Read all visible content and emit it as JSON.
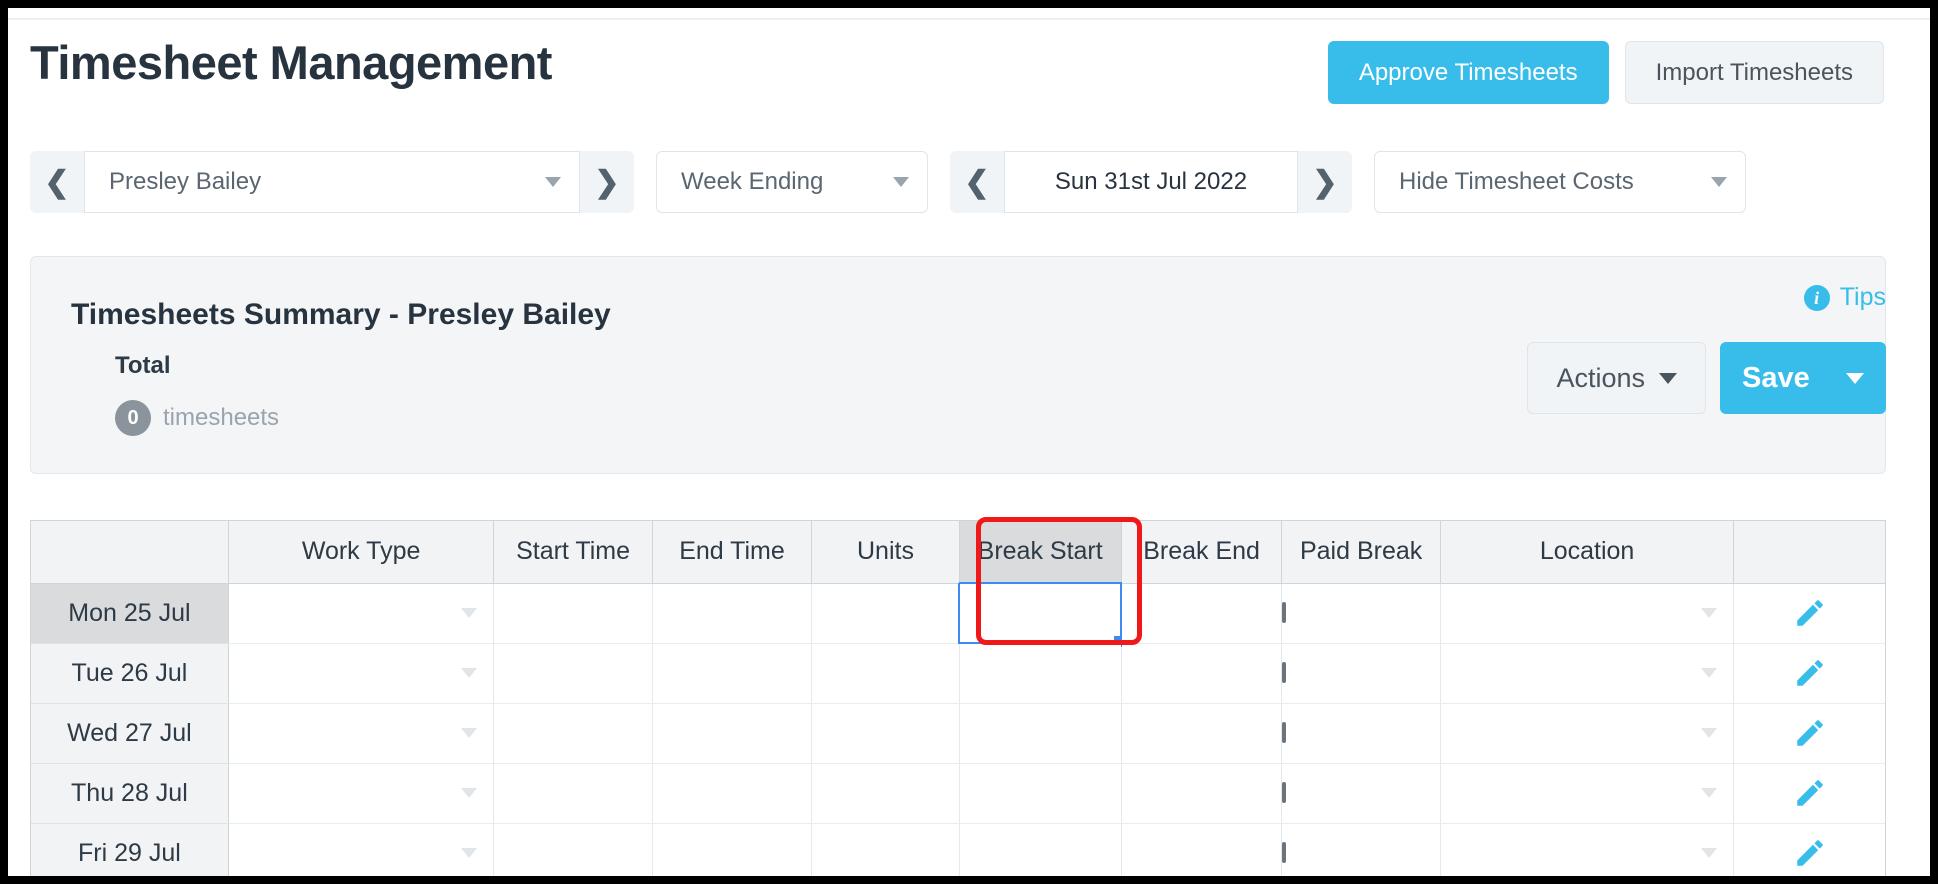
{
  "header": {
    "title": "Timesheet Management",
    "approve_label": "Approve Timesheets",
    "import_label": "Import Timesheets"
  },
  "filters": {
    "employee": {
      "value": "Presley Bailey",
      "prev_icon": "chevron-left",
      "next_icon": "chevron-right"
    },
    "period_type": {
      "value": "Week Ending"
    },
    "date": {
      "value": "Sun 31st Jul 2022",
      "prev_icon": "chevron-left",
      "next_icon": "chevron-right"
    },
    "costs": {
      "value": "Hide Timesheet Costs"
    }
  },
  "summary": {
    "title": "Timesheets Summary - Presley Bailey",
    "total_label": "Total",
    "count": "0",
    "count_word": "timesheets",
    "tips_label": "Tips",
    "actions_label": "Actions",
    "save_label": "Save"
  },
  "grid": {
    "columns": [
      "",
      "Work Type",
      "Start Time",
      "End Time",
      "Units",
      "Break Start",
      "Break End",
      "Paid Break",
      "Location",
      ""
    ],
    "rows": [
      {
        "day": "Mon 25 Jul",
        "work_type": "",
        "start_time": "",
        "end_time": "",
        "units": "",
        "break_start": "",
        "break_end": "",
        "paid_break": false,
        "location": ""
      },
      {
        "day": "Tue 26 Jul",
        "work_type": "",
        "start_time": "",
        "end_time": "",
        "units": "",
        "break_start": "",
        "break_end": "",
        "paid_break": false,
        "location": ""
      },
      {
        "day": "Wed 27 Jul",
        "work_type": "",
        "start_time": "",
        "end_time": "",
        "units": "",
        "break_start": "",
        "break_end": "",
        "paid_break": false,
        "location": ""
      },
      {
        "day": "Thu 28 Jul",
        "work_type": "",
        "start_time": "",
        "end_time": "",
        "units": "",
        "break_start": "",
        "break_end": "",
        "paid_break": false,
        "location": ""
      },
      {
        "day": "Fri 29 Jul",
        "work_type": "",
        "start_time": "",
        "end_time": "",
        "units": "",
        "break_start": "",
        "break_end": "",
        "paid_break": false,
        "location": ""
      }
    ],
    "selected_cell": {
      "row": "Mon 25 Jul",
      "column": "Break Start"
    },
    "row_action_icon": "pencil-icon"
  },
  "colors": {
    "accent": "#38bdeb",
    "title": "#27333f",
    "panel": "#f4f5f6",
    "header_cell": "#f1f3f4",
    "highlight_cell": "#d9dbdd",
    "selection_border": "#3d8bf2",
    "annotation": "#f01818"
  }
}
